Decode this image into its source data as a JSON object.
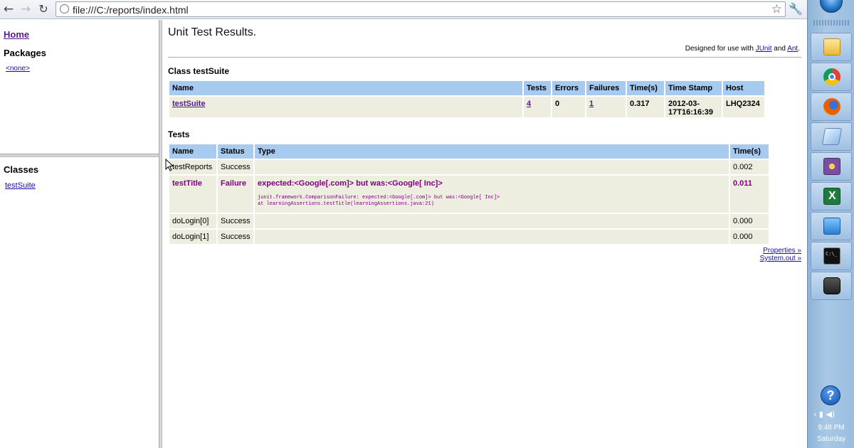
{
  "browser": {
    "url": "file:///C:/reports/index.html",
    "back_glyph": "←",
    "forward_glyph": "→",
    "reload_glyph": "↻",
    "star_glyph": "☆",
    "wrench_glyph": "🔧",
    "icons": [
      "back-arrow-icon",
      "forward-arrow-icon",
      "reload-icon",
      "page-icon",
      "star-icon",
      "wrench-icon"
    ]
  },
  "nav": {
    "home": "Home",
    "packages_heading": "Packages",
    "packages": [
      "<none>"
    ],
    "classes_heading": "Classes",
    "classes": [
      "testSuite"
    ]
  },
  "report": {
    "title": "Unit Test Results.",
    "designed_prefix": "Designed for use with ",
    "junit_link": "JUnit",
    "designed_and": " and ",
    "ant_link": "Ant",
    "designed_suffix": ".",
    "class_heading": "Class testSuite",
    "tests_heading": "Tests",
    "class_table": {
      "headers": [
        "Name",
        "Tests",
        "Errors",
        "Failures",
        "Time(s)",
        "Time Stamp",
        "Host"
      ],
      "row": {
        "name": "testSuite",
        "tests": "4",
        "errors": "0",
        "failures": "1",
        "time": "0.317",
        "timestamp_line1": "2012-03-",
        "timestamp_line2": "17T16:16:39",
        "host": "LHQ2324"
      }
    },
    "tests_table": {
      "headers": [
        "Name",
        "Status",
        "Type",
        "Time(s)"
      ],
      "rows": [
        {
          "name": "testReports",
          "status": "Success",
          "type": "",
          "time": "0.002"
        },
        {
          "name": "testTitle",
          "status": "Failure",
          "type": "expected:<Google[.com]> but was:<Google[ Inc]>",
          "trace_line1": "junit.framework.ComparisonFailure: expected:<Google[.com]> but was:<Google[ Inc]>",
          "trace_line2": "at learningAssertions.testTitle(learningAssertions.java:21)",
          "time": "0.011"
        },
        {
          "name": "doLogin[0]",
          "status": "Success",
          "type": "",
          "time": "0.000"
        },
        {
          "name": "doLogin[1]",
          "status": "Success",
          "type": "",
          "time": "0.000"
        }
      ]
    },
    "properties_link": "Properties »",
    "system_out_link": "System.out »"
  },
  "taskbar": {
    "items": [
      "explorer-icon",
      "chrome-icon",
      "firefox-icon",
      "notepad-icon",
      "tool-icon",
      "excel-icon",
      "network-icon",
      "cmd-icon",
      "camera-icon"
    ],
    "help_glyph": "?",
    "tray": "‹ ▮ ◀)",
    "time": "9:48 PM",
    "day": "Saturday"
  }
}
